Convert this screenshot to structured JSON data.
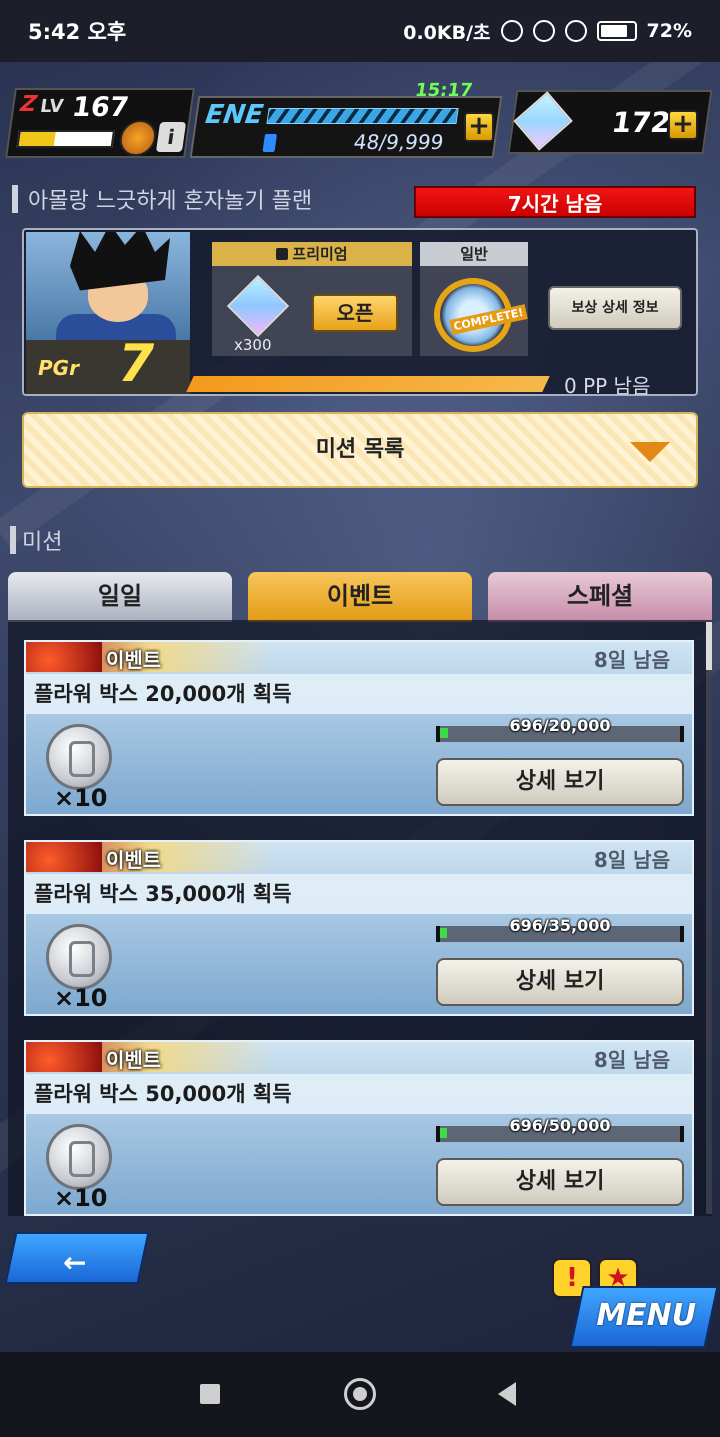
{
  "status_bar": {
    "time": "5:42 오후",
    "network": "0.0KB/초",
    "battery": "72%"
  },
  "hud": {
    "z_label": "Z",
    "lv_label": "LV",
    "level": "167",
    "info_icon": "i",
    "xp_fraction": 0.38,
    "ene_label": "ENE",
    "ene_timer": "15:17",
    "energy_value": "48/9,999",
    "stone_value": "172",
    "plus_symbol": "+"
  },
  "plan": {
    "title": "아몰랑 느긋하게 혼자놀기 플랜",
    "time_remaining": "7시간 남음",
    "premium_label": "프리미엄",
    "premium_reward_qty": "x300",
    "open_button": "오픈",
    "normal_label": "일반",
    "complete_label": "COMPLETE!",
    "reward_detail_button": "보상 상세 정보",
    "pgr_label": "PGr",
    "pgr_value": "7",
    "pp_remaining": "0 PP 남음"
  },
  "mission_list_button": "미션 목록",
  "mission_section_title": "미션",
  "tabs": [
    {
      "label": "일일",
      "active": false
    },
    {
      "label": "이벤트",
      "active": true
    },
    {
      "label": "스페셜",
      "active": false
    }
  ],
  "missions": [
    {
      "tag": "이벤트",
      "days_left": "8일 남음",
      "title": "플라워 박스 20,000개 획득",
      "reward_qty": "×10",
      "progress_text": "696/20,000",
      "progress_fraction": 0.0348,
      "detail_button": "상세 보기"
    },
    {
      "tag": "이벤트",
      "days_left": "8일 남음",
      "title": "플라워 박스 35,000개 획득",
      "reward_qty": "×10",
      "progress_text": "696/35,000",
      "progress_fraction": 0.0199,
      "detail_button": "상세 보기"
    },
    {
      "tag": "이벤트",
      "days_left": "8일 남음",
      "title": "플라워 박스 50,000개 획득",
      "reward_qty": "×10",
      "progress_text": "696/50,000",
      "progress_fraction": 0.0139,
      "detail_button": "상세 보기"
    }
  ],
  "bottom": {
    "menu_label": "MENU",
    "alert_1": "!",
    "alert_2": "★"
  },
  "icons": {
    "back": "arrow-left-icon",
    "nav_recent": "square-icon",
    "nav_home": "home-circle-icon",
    "nav_back": "triangle-back-icon"
  }
}
